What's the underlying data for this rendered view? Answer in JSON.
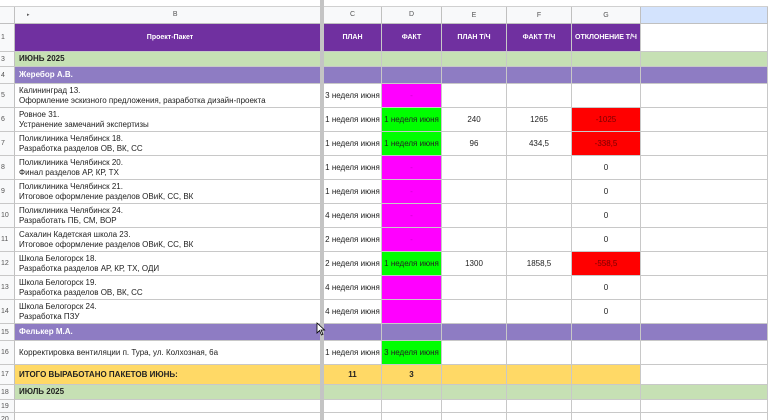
{
  "columns": [
    "B",
    "C",
    "D",
    "E",
    "F",
    "G"
  ],
  "header": {
    "row_num": "1",
    "project": "Проект-Пакет",
    "plan": "ПЛАН",
    "fact": "ФАКТ",
    "plan_th": "ПЛАН Т/Ч",
    "fact_th": "ФАКТ Т/Ч",
    "deviation": "ОТКЛОНЕНИЕ Т/Ч"
  },
  "rows": [
    {
      "num": "3",
      "kind": "month",
      "label": "ИЮНЬ 2025"
    },
    {
      "num": "4",
      "kind": "person",
      "label": "Жеребор А.В."
    },
    {
      "num": "5",
      "kind": "item",
      "line1": "Калининград 13.",
      "line2": "Оформление эскизного предложения, разработка дизайн-проекта",
      "plan": "3 неделя июня",
      "fact": "-",
      "fact_color": "magenta",
      "plan_th": "",
      "fact_th": "",
      "dev": "",
      "dev_color": ""
    },
    {
      "num": "6",
      "kind": "item",
      "line1": "Ровное 31.",
      "line2": "Устранение замечаний экспертизы",
      "plan": "1 неделя июня",
      "fact": "1 неделя июня",
      "fact_color": "green",
      "plan_th": "240",
      "fact_th": "1265",
      "dev": "-1025",
      "dev_color": "red"
    },
    {
      "num": "7",
      "kind": "item",
      "line1": "Поликлиника Челябинск 18.",
      "line2": "Разработка разделов ОВ, ВК, СС",
      "plan": "1 неделя июня",
      "fact": "1 неделя июня",
      "fact_color": "green",
      "plan_th": "96",
      "fact_th": "434,5",
      "dev": "-338,5",
      "dev_color": "red"
    },
    {
      "num": "8",
      "kind": "item",
      "line1": "Поликлиника Челябинск 20.",
      "line2": "Финал разделов АР, КР, ТХ",
      "plan": "1 неделя июня",
      "fact": "-",
      "fact_color": "magenta",
      "plan_th": "",
      "fact_th": "",
      "dev": "0",
      "dev_color": ""
    },
    {
      "num": "9",
      "kind": "item",
      "line1": "Поликлиника Челябинск 21.",
      "line2": "Итоговое оформление разделов ОВиК, СС, ВК",
      "plan": "1 неделя июня",
      "fact": "-",
      "fact_color": "magenta",
      "plan_th": "",
      "fact_th": "",
      "dev": "0",
      "dev_color": ""
    },
    {
      "num": "10",
      "kind": "item",
      "line1": "Поликлиника Челябинск 24.",
      "line2": "Разработать ПБ, СМ, ВОР",
      "plan": "4 неделя июня",
      "fact": "-",
      "fact_color": "magenta",
      "plan_th": "",
      "fact_th": "",
      "dev": "0",
      "dev_color": ""
    },
    {
      "num": "11",
      "kind": "item",
      "line1": "Сахалин Кадетская школа  23.",
      "line2": "Итоговое оформление разделов ОВиК, СС, ВК",
      "plan": "2 неделя июня",
      "fact": "-",
      "fact_color": "magenta",
      "plan_th": "",
      "fact_th": "",
      "dev": "0",
      "dev_color": ""
    },
    {
      "num": "12",
      "kind": "item",
      "line1": "Школа Белогорск 18.",
      "line2": "Разработка разделов АР, КР, ТХ, ОДИ",
      "plan": "2 неделя июня",
      "fact": "1 неделя июня",
      "fact_color": "green",
      "plan_th": "1300",
      "fact_th": "1858,5",
      "dev": "-558,5",
      "dev_color": "red"
    },
    {
      "num": "13",
      "kind": "item",
      "line1": "Школа Белогорск 19.",
      "line2": "Разработка разделов ОВ, ВК, СС",
      "plan": "4 неделя июня",
      "fact": "",
      "fact_color": "magenta",
      "plan_th": "",
      "fact_th": "",
      "dev": "0",
      "dev_color": ""
    },
    {
      "num": "14",
      "kind": "item",
      "line1": "Школа Белогорск 24.",
      "line2": "Разработка ПЗУ",
      "plan": "4 неделя июня",
      "fact": "",
      "fact_color": "magenta",
      "plan_th": "",
      "fact_th": "",
      "dev": "0",
      "dev_color": ""
    },
    {
      "num": "15",
      "kind": "person",
      "label": "Фелькер М.А."
    },
    {
      "num": "16",
      "kind": "item",
      "line1": "",
      "line2": "Корректировка вентиляции п. Тура, ул. Колхозная, 6а",
      "plan": "1 неделя июня",
      "fact": "3 неделя июня",
      "fact_color": "green",
      "plan_th": "",
      "fact_th": "",
      "dev": "",
      "dev_color": ""
    },
    {
      "num": "17",
      "kind": "total",
      "label": "ИТОГО ВЫРАБОТАНО ПАКЕТОВ ИЮНЬ:",
      "plan": "11",
      "fact": "3"
    },
    {
      "num": "18",
      "kind": "month",
      "label": "ИЮЛЬ 2025"
    },
    {
      "num": "19",
      "kind": "blank"
    },
    {
      "num": "20",
      "kind": "blank"
    }
  ],
  "colors": {
    "header_purple": "#7030a0",
    "person_lavender": "#8e7cc3",
    "month_green": "#c6e0b4",
    "total_yellow": "#ffd966",
    "fact_magenta": "#ff00ff",
    "fact_green": "#00ff00",
    "dev_red": "#ff0000"
  }
}
